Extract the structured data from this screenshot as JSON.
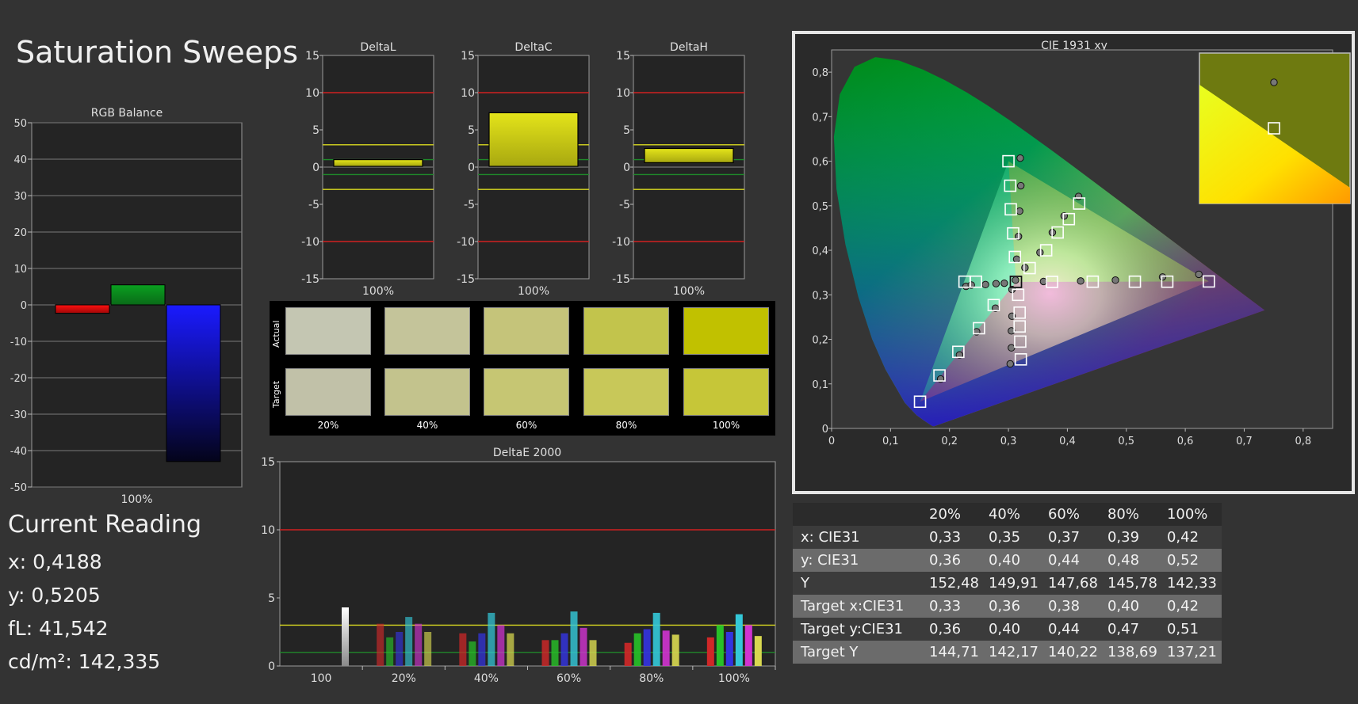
{
  "page_title": "Saturation Sweeps",
  "rgb_balance": {
    "title": "RGB Balance",
    "y_ticks": [
      "50",
      "40",
      "30",
      "20",
      "10",
      "0",
      "-10",
      "-20",
      "-30",
      "-40",
      "-50"
    ],
    "x_label": "100%",
    "bars": [
      {
        "channel": "red",
        "value": -2.3,
        "color": "#ff1010"
      },
      {
        "channel": "green",
        "value": 5.5,
        "color": "#0aa020"
      },
      {
        "channel": "blue",
        "value": -43,
        "color": "#1a1aff"
      }
    ]
  },
  "delta_charts": [
    {
      "title": "DeltaL",
      "x_label": "100%",
      "value_top": 1.0,
      "value_bottom": 0.1
    },
    {
      "title": "DeltaC",
      "x_label": "100%",
      "value_top": 7.3,
      "value_bottom": 0.1
    },
    {
      "title": "DeltaH",
      "x_label": "100%",
      "value_top": 2.5,
      "value_bottom": 0.6
    }
  ],
  "delta_ticks": [
    "15",
    "10",
    "5",
    "0",
    "-5",
    "-10",
    "-15"
  ],
  "swatches": {
    "row_labels": [
      "Actual",
      "Target"
    ],
    "percent_labels": [
      "20%",
      "40%",
      "60%",
      "80%",
      "100%"
    ],
    "actual_colors": [
      "#c4c6b2",
      "#c4c49a",
      "#c5c47a",
      "#c2c44c",
      "#c1c100"
    ],
    "target_colors": [
      "#c1c1a8",
      "#c3c38d",
      "#c6c673",
      "#c8c859",
      "#c6c638"
    ]
  },
  "deltae": {
    "title": "DeltaE 2000",
    "y_ticks": [
      "15",
      "10",
      "5",
      "0"
    ],
    "x_labels": [
      "100",
      "20%",
      "40%",
      "60%",
      "80%",
      "100%"
    ],
    "bar_colors": [
      "#d02828",
      "#28c028",
      "#3434e0",
      "#34c8d8",
      "#d034d0",
      "#d8d850"
    ],
    "groups": [
      {
        "label": "100",
        "values": [
          4.3
        ]
      },
      {
        "label": "20%",
        "values": [
          3.1,
          2.1,
          2.5,
          3.6,
          3.1,
          2.5
        ]
      },
      {
        "label": "40%",
        "values": [
          2.4,
          1.8,
          2.4,
          3.9,
          3.0,
          2.4
        ]
      },
      {
        "label": "60%",
        "values": [
          1.9,
          1.9,
          2.4,
          4.0,
          2.8,
          1.9
        ]
      },
      {
        "label": "80%",
        "values": [
          1.7,
          2.4,
          2.7,
          3.9,
          2.6,
          2.3
        ]
      },
      {
        "label": "100%",
        "values": [
          2.1,
          3.0,
          2.5,
          3.8,
          3.0,
          2.2
        ]
      }
    ]
  },
  "cie": {
    "title": "CIE 1931 xy",
    "x_ticks": [
      "0",
      "0,1",
      "0,2",
      "0,3",
      "0,4",
      "0,5",
      "0,6",
      "0,7",
      "0,8"
    ],
    "y_ticks": [
      "0",
      "0,1",
      "0,2",
      "0,3",
      "0,4",
      "0,5",
      "0,6",
      "0,7",
      "0,8"
    ],
    "gamut_triangle": [
      [
        0.64,
        0.33
      ],
      [
        0.3,
        0.6
      ],
      [
        0.15,
        0.06
      ]
    ],
    "target_squares": [
      [
        0.3,
        0.6
      ],
      [
        0.303,
        0.545
      ],
      [
        0.304,
        0.492
      ],
      [
        0.308,
        0.438
      ],
      [
        0.311,
        0.385
      ],
      [
        0.3127,
        0.329
      ],
      [
        0.2255,
        0.3295
      ],
      [
        0.245,
        0.3295
      ],
      [
        0.275,
        0.277
      ],
      [
        0.25,
        0.225
      ],
      [
        0.215,
        0.172
      ],
      [
        0.183,
        0.119
      ],
      [
        0.15,
        0.06
      ],
      [
        0.3127,
        0.329
      ],
      [
        0.3165,
        0.3
      ],
      [
        0.319,
        0.26
      ],
      [
        0.319,
        0.229
      ],
      [
        0.32,
        0.195
      ],
      [
        0.321,
        0.155
      ],
      [
        0.3127,
        0.329
      ],
      [
        0.374,
        0.329
      ],
      [
        0.443,
        0.3295
      ],
      [
        0.5145,
        0.3295
      ],
      [
        0.5695,
        0.3295
      ],
      [
        0.64,
        0.33
      ],
      [
        0.3127,
        0.329
      ],
      [
        0.336,
        0.36
      ],
      [
        0.364,
        0.4
      ],
      [
        0.3835,
        0.44
      ],
      [
        0.4025,
        0.47
      ],
      [
        0.42,
        0.505
      ]
    ],
    "measured_points": [
      [
        0.32,
        0.607
      ],
      [
        0.321,
        0.545
      ],
      [
        0.319,
        0.488
      ],
      [
        0.317,
        0.431
      ],
      [
        0.314,
        0.38
      ],
      [
        0.312,
        0.333
      ],
      [
        0.228,
        0.319
      ],
      [
        0.237,
        0.322
      ],
      [
        0.261,
        0.323
      ],
      [
        0.279,
        0.325
      ],
      [
        0.293,
        0.326
      ],
      [
        0.278,
        0.27
      ],
      [
        0.246,
        0.217
      ],
      [
        0.217,
        0.165
      ],
      [
        0.185,
        0.111
      ],
      [
        0.306,
        0.312
      ],
      [
        0.306,
        0.252
      ],
      [
        0.305,
        0.219
      ],
      [
        0.305,
        0.181
      ],
      [
        0.303,
        0.145
      ],
      [
        0.3595,
        0.33
      ],
      [
        0.4225,
        0.331
      ],
      [
        0.4815,
        0.333
      ],
      [
        0.5615,
        0.34
      ],
      [
        0.623,
        0.346
      ],
      [
        0.328,
        0.361
      ],
      [
        0.3535,
        0.395
      ],
      [
        0.3745,
        0.44
      ],
      [
        0.3945,
        0.477
      ],
      [
        0.419,
        0.521
      ]
    ],
    "inset_square": [
      0.42,
      0.505
    ],
    "inset_point": [
      0.4188,
      0.5205
    ]
  },
  "current_reading": {
    "heading": "Current Reading",
    "x_line": "x: 0,4188",
    "y_line": "y: 0,5205",
    "fl_line": "fL: 41,542",
    "cd_line": "cd/m²: 142,335"
  },
  "table": {
    "headers": [
      "20%",
      "40%",
      "60%",
      "80%",
      "100%"
    ],
    "rows": [
      {
        "label": "x: CIE31",
        "values": [
          "0,33",
          "0,35",
          "0,37",
          "0,39",
          "0,42"
        ]
      },
      {
        "label": "y: CIE31",
        "values": [
          "0,36",
          "0,40",
          "0,44",
          "0,48",
          "0,52"
        ]
      },
      {
        "label": "Y",
        "values": [
          "152,48",
          "149,91",
          "147,68",
          "145,78",
          "142,33"
        ]
      },
      {
        "label": "Target x:CIE31",
        "values": [
          "0,33",
          "0,36",
          "0,38",
          "0,40",
          "0,42"
        ]
      },
      {
        "label": "Target y:CIE31",
        "values": [
          "0,36",
          "0,40",
          "0,44",
          "0,47",
          "0,51"
        ]
      },
      {
        "label": "Target Y",
        "values": [
          "144,71",
          "142,17",
          "140,22",
          "138,69",
          "137,21"
        ]
      }
    ]
  }
}
